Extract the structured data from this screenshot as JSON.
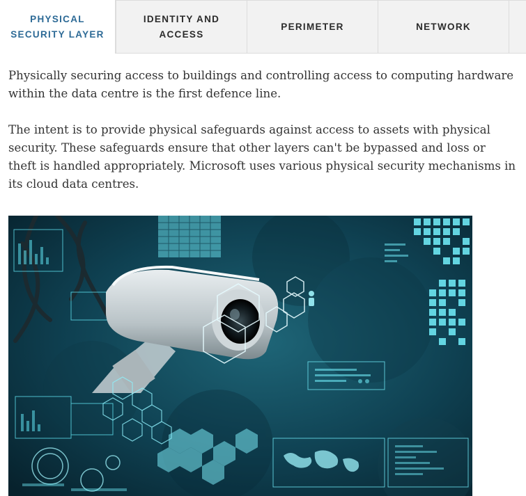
{
  "tabs": [
    {
      "line1": "PHYSICAL",
      "line2": "SECURITY LAYER",
      "active": true
    },
    {
      "line1": "IDENTITY AND",
      "line2": "ACCESS",
      "active": false
    },
    {
      "line1": "PERIMETER",
      "line2": "",
      "active": false
    },
    {
      "line1": "NETWORK",
      "line2": "",
      "active": false
    }
  ],
  "content": {
    "paragraphs": [
      "Physically securing access to buildings and controlling access to computing hardware within the data centre is the first defence line.",
      "The intent is to provide physical safeguards against access to assets with physical security. These safeguards ensure that other layers can't be bypassed and loss or theft is handled appropriately. Microsoft uses various physical security mechanisms in its cloud data centres."
    ]
  },
  "image": {
    "subject": "security-camera-illustration"
  },
  "colors": {
    "active_tab_text": "#2d6a96",
    "inactive_tab_bg": "#f2f2f2",
    "body_text": "#333333",
    "image_base": "#0b3342",
    "image_accent": "#4fd6e8"
  }
}
